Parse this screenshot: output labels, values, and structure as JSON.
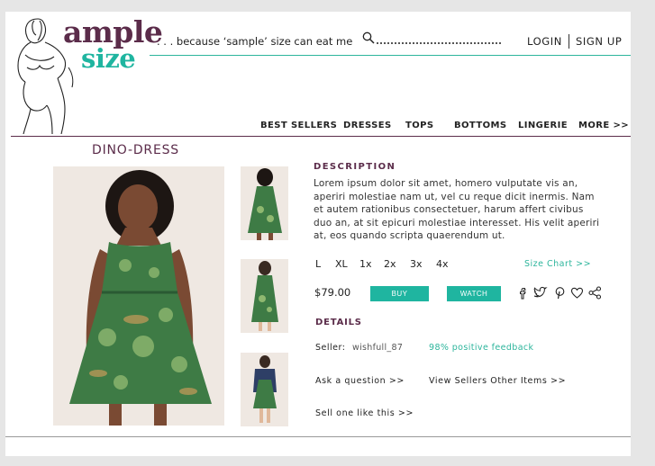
{
  "brand": {
    "ample": "ample",
    "size": "size",
    "tagline": ". . . because ‘sample’ size can eat me",
    "colors": {
      "purple": "#5b2c4a",
      "teal": "#1fb5a0"
    }
  },
  "header": {
    "login": "LOGIN",
    "signup": "SIGN UP",
    "search_icon": "search-icon"
  },
  "nav": [
    "BEST SELLERS",
    "DRESSES",
    "TOPS",
    "BOTTOMS",
    "LINGERIE",
    "MORE >>"
  ],
  "product": {
    "title": "DINO-DRESS",
    "description_heading": "DESCRIPTION",
    "description": "Lorem ipsum dolor sit amet, homero vulputate vis an, aperiri molestiae nam ut, vel cu reque dicit inermis. Nam et autem rationibus consectetuer, harum affert civibus duo an, at sit epicuri molestiae interesset. His velit aperiri at, eos quando scripta quaerendum ut.",
    "sizes": [
      "L",
      "XL",
      "1x",
      "2x",
      "3x",
      "4x"
    ],
    "size_chart": "Size Chart >>",
    "price": "$79.00",
    "buy": "BUY",
    "watch": "WATCH",
    "social_icons": [
      "facebook-icon",
      "twitter-icon",
      "pinterest-icon",
      "heart-icon",
      "share-icon"
    ],
    "details_heading": "DETAILS",
    "seller_label": "Seller:",
    "seller_name": "wishfull_87",
    "feedback": "98% positive feedback",
    "ask_question": "Ask a question >>",
    "other_items": "View Sellers Other Items >>",
    "sell_like": "Sell one like this >>"
  }
}
